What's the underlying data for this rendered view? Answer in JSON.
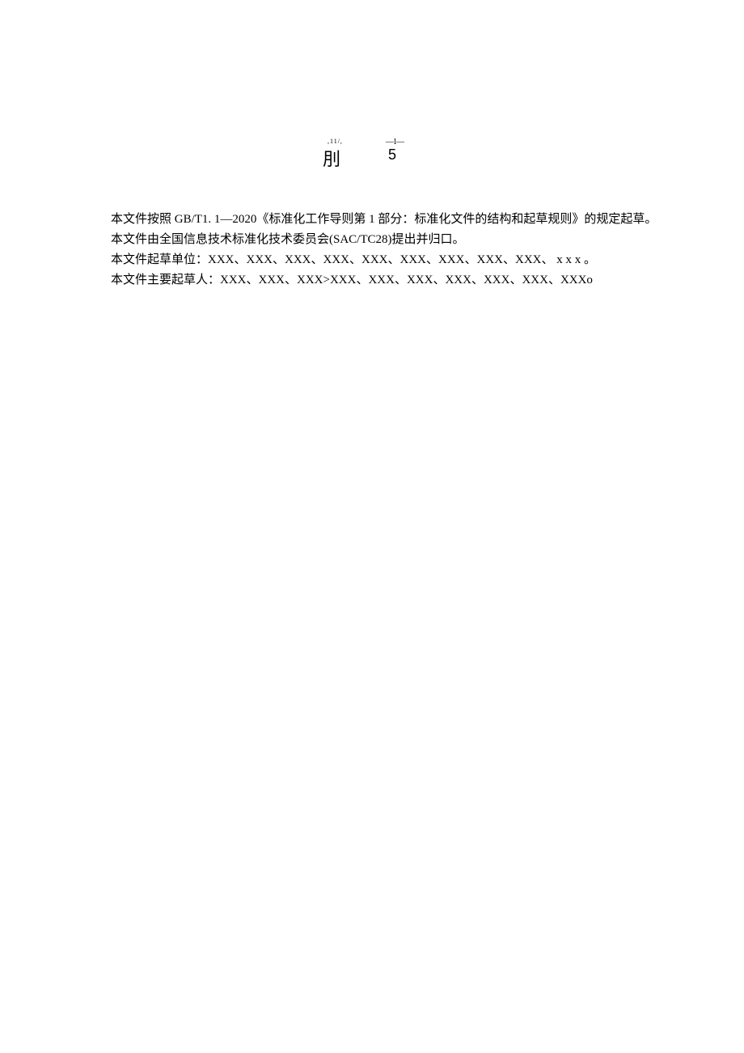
{
  "heading": {
    "small_mark": ",11/,",
    "dash_top": "—1—",
    "char": "刖",
    "num": "5"
  },
  "paragraphs": [
    "本文件按照 GB/T1. 1—2020《标准化工作导则第 1 部分：标准化文件的结构和起草规则》的规定起草。",
    "本文件由全国信息技术标准化技术委员会(SAC/TC28)提出并归口。",
    "本文件起草单位：XXX、XXX、XXX、XXX、XXX、XXX、XXX、XXX、XXX、 x x x 。",
    "本文件主要起草人：XXX、XXX、XXX>XXX、XXX、XXX、XXX、XXX、XXX、XXXo"
  ]
}
